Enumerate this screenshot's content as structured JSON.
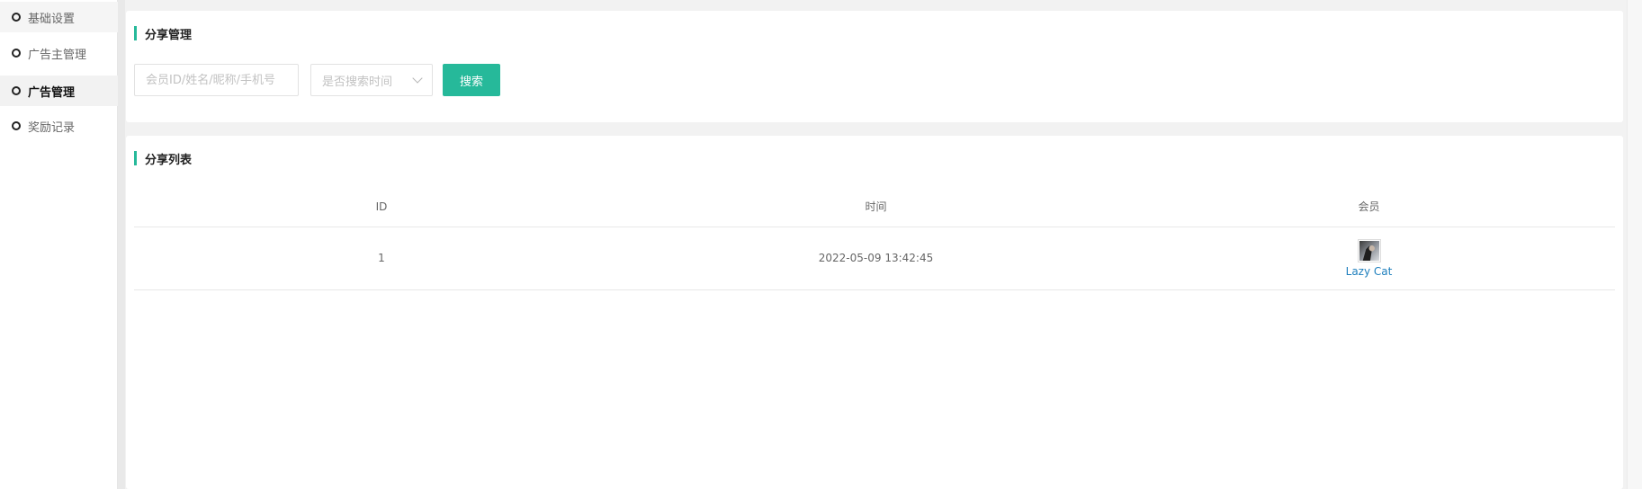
{
  "sidebar": {
    "items": [
      {
        "label": "基础设置",
        "active": false
      },
      {
        "label": "广告主管理",
        "active": false
      },
      {
        "label": "广告管理",
        "active": true
      },
      {
        "label": "奖励记录",
        "active": false
      }
    ]
  },
  "search_panel": {
    "title": "分享管理",
    "member_input_placeholder": "会员ID/姓名/昵称/手机号",
    "member_input_value": "",
    "time_select_value": "是否搜索时间",
    "search_button_label": "搜索"
  },
  "list_panel": {
    "title": "分享列表",
    "columns": [
      "ID",
      "时间",
      "会员"
    ],
    "rows": [
      {
        "id": "1",
        "time": "2022-05-09 13:42:45",
        "member": "Lazy Cat"
      }
    ]
  },
  "colors": {
    "accent": "#26b99a",
    "link": "#1e7fbd"
  }
}
